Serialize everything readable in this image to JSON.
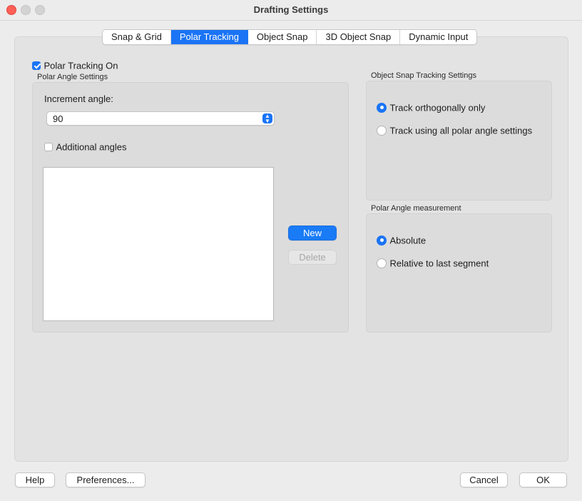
{
  "window": {
    "title": "Drafting Settings"
  },
  "tabs": [
    {
      "label": "Snap & Grid",
      "active": false
    },
    {
      "label": "Polar Tracking",
      "active": true
    },
    {
      "label": "Object Snap",
      "active": false
    },
    {
      "label": "3D Object Snap",
      "active": false
    },
    {
      "label": "Dynamic Input",
      "active": false
    }
  ],
  "polar": {
    "on_label": "Polar Tracking On",
    "on_checked": true,
    "angle_section_title": "Polar Angle Settings",
    "increment_label": "Increment angle:",
    "increment_value": "90",
    "additional_label": "Additional angles",
    "additional_checked": false,
    "new_label": "New",
    "delete_label": "Delete"
  },
  "osnap_tracking": {
    "title": "Object Snap Tracking Settings",
    "options": [
      {
        "label": "Track orthogonally only",
        "selected": true
      },
      {
        "label": "Track using all polar angle settings",
        "selected": false
      }
    ]
  },
  "measurement": {
    "title": "Polar Angle measurement",
    "options": [
      {
        "label": "Absolute",
        "selected": true
      },
      {
        "label": "Relative to last segment",
        "selected": false
      }
    ]
  },
  "footer": {
    "help": "Help",
    "preferences": "Preferences...",
    "cancel": "Cancel",
    "ok": "OK"
  },
  "colors": {
    "accent": "#1a74f5"
  }
}
